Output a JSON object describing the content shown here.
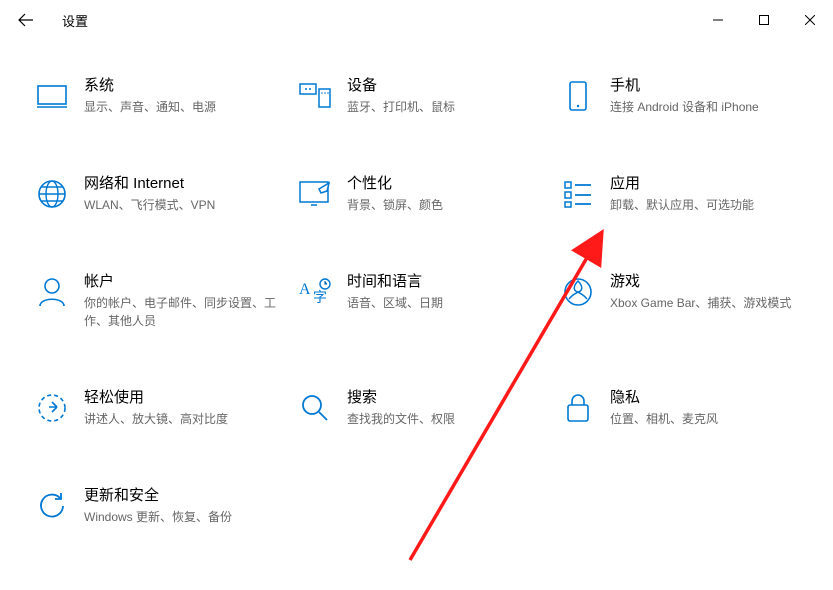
{
  "window": {
    "title": "设置"
  },
  "categories": [
    {
      "id": "system",
      "title": "系统",
      "desc": "显示、声音、通知、电源"
    },
    {
      "id": "devices",
      "title": "设备",
      "desc": "蓝牙、打印机、鼠标"
    },
    {
      "id": "phone",
      "title": "手机",
      "desc": "连接 Android 设备和 iPhone"
    },
    {
      "id": "network",
      "title": "网络和 Internet",
      "desc": "WLAN、飞行模式、VPN"
    },
    {
      "id": "personalization",
      "title": "个性化",
      "desc": "背景、锁屏、颜色"
    },
    {
      "id": "apps",
      "title": "应用",
      "desc": "卸载、默认应用、可选功能"
    },
    {
      "id": "accounts",
      "title": "帐户",
      "desc": "你的帐户、电子邮件、同步设置、工作、其他人员"
    },
    {
      "id": "time",
      "title": "时间和语言",
      "desc": "语音、区域、日期"
    },
    {
      "id": "gaming",
      "title": "游戏",
      "desc": "Xbox Game Bar、捕获、游戏模式"
    },
    {
      "id": "ease",
      "title": "轻松使用",
      "desc": "讲述人、放大镜、高对比度"
    },
    {
      "id": "search",
      "title": "搜索",
      "desc": "查找我的文件、权限"
    },
    {
      "id": "privacy",
      "title": "隐私",
      "desc": "位置、相机、麦克风"
    },
    {
      "id": "update",
      "title": "更新和安全",
      "desc": "Windows 更新、恢复、备份"
    }
  ]
}
